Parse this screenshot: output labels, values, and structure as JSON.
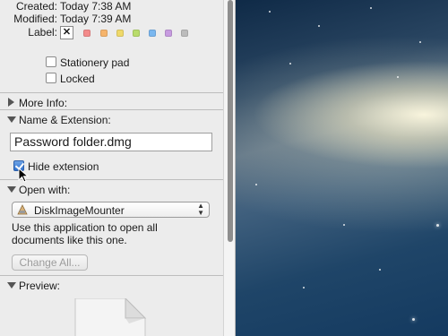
{
  "general": {
    "created_label": "Created:",
    "created_value": "Today 7:38 AM",
    "modified_label": "Modified:",
    "modified_value": "Today 7:39 AM",
    "label_label": "Label:",
    "label_none_symbol": "✕",
    "label_colors": [
      "#f38b8b",
      "#f6b46b",
      "#efd96a",
      "#b9dc6b",
      "#7ab7ef",
      "#c79be0",
      "#bcbcbc"
    ],
    "stationery_pad": "Stationery pad",
    "locked": "Locked"
  },
  "sections": {
    "more_info": "More Info:",
    "name_extension": "Name & Extension:",
    "open_with": "Open with:",
    "preview": "Preview:"
  },
  "name_extension": {
    "file_name": "Password folder.dmg",
    "hide_extension": "Hide extension",
    "hide_extension_checked": true
  },
  "open_with": {
    "application": "DiskImageMounter",
    "description_line1": "Use this application to open all",
    "description_line2": "documents like this one.",
    "change_all": "Change All..."
  }
}
